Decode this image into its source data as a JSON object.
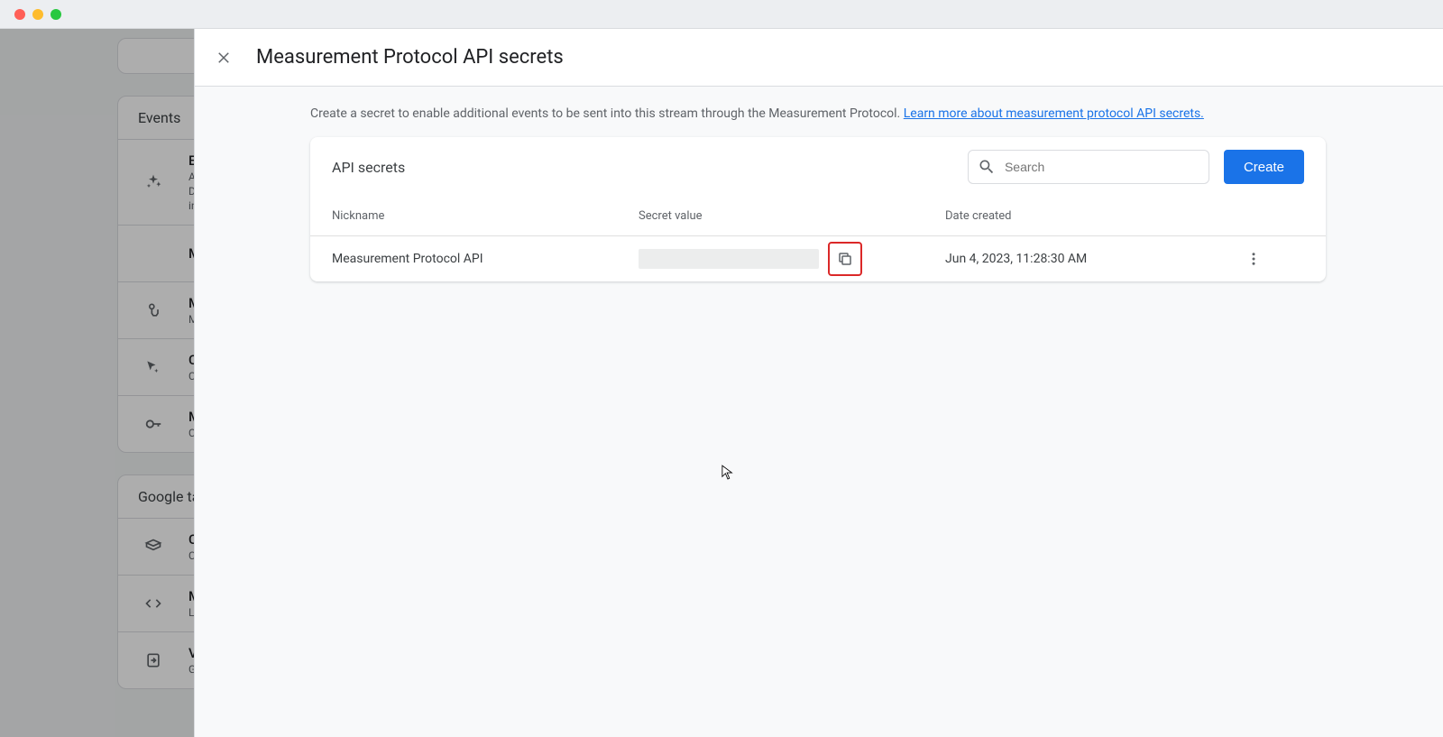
{
  "modal": {
    "title": "Measurement Protocol API secrets",
    "intro_text": "Create a secret to enable additional events to be sent into this stream through the Measurement Protocol. ",
    "learn_more": "Learn more about measurement protocol API secrets.",
    "card_title": "API secrets",
    "search_placeholder": "Search",
    "create_label": "Create",
    "columns": {
      "nickname": "Nickname",
      "secret": "Secret value",
      "date": "Date created"
    },
    "rows": [
      {
        "nickname": "Measurement Protocol API",
        "date": "Jun 4, 2023, 11:28:30 AM"
      }
    ]
  },
  "background": {
    "section1": "Events",
    "section2": "Google ta",
    "items": [
      {
        "title": "En",
        "sub1": "Au",
        "sub2": "Da",
        "sub3": "inf",
        "icon": "sparkle"
      },
      {
        "title": "Me",
        "sub1": "",
        "icon": "none"
      },
      {
        "title": "Mo",
        "sub1": "Mo",
        "icon": "touch"
      },
      {
        "title": "Cr",
        "sub1": "Cr",
        "icon": "cursor-sparkle"
      },
      {
        "title": "Me",
        "sub1": "Cr",
        "icon": "key"
      }
    ],
    "items2": [
      {
        "title": "Co",
        "sub1": "Co",
        "icon": "tag"
      },
      {
        "title": "Ma",
        "sub1": "Lo",
        "icon": "code"
      },
      {
        "title": "Vi",
        "sub1": "Ge",
        "icon": "clipboard"
      }
    ]
  }
}
